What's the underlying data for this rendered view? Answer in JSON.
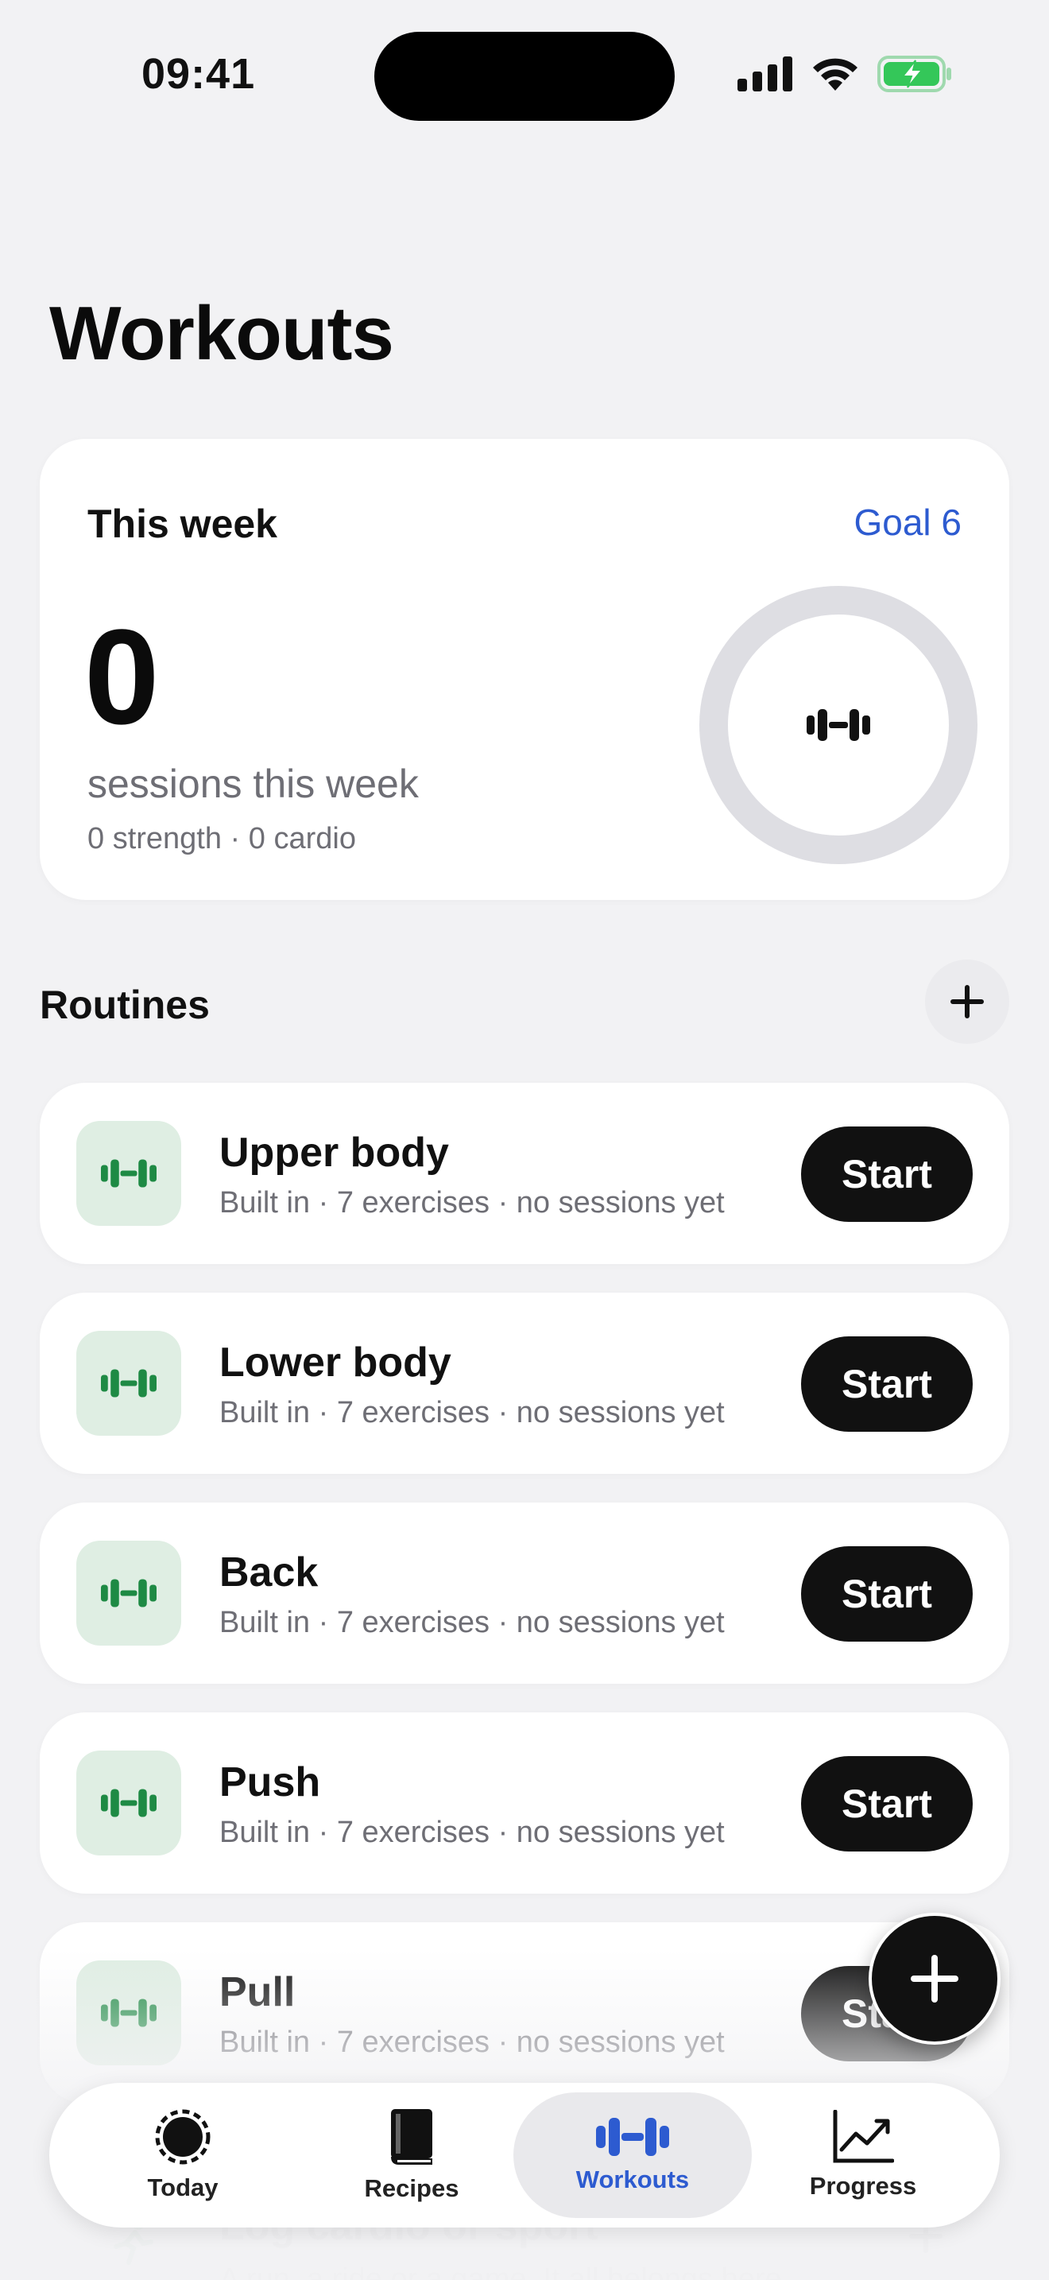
{
  "status_bar": {
    "time": "09:41"
  },
  "page": {
    "title": "Workouts"
  },
  "week": {
    "label": "This week",
    "goal_link": "Goal 6",
    "count": "0",
    "subtitle": "sessions this week",
    "breakdown": "0 strength · 0 cardio",
    "progress_fraction": 0
  },
  "routines_section": {
    "title": "Routines"
  },
  "routines": [
    {
      "name": "Upper body",
      "meta": "Built in · 7 exercises · no sessions yet",
      "start_label": "Start"
    },
    {
      "name": "Lower body",
      "meta": "Built in · 7 exercises · no sessions yet",
      "start_label": "Start"
    },
    {
      "name": "Back",
      "meta": "Built in · 7 exercises · no sessions yet",
      "start_label": "Start"
    },
    {
      "name": "Push",
      "meta": "Built in · 7 exercises · no sessions yet",
      "start_label": "Start"
    },
    {
      "name": "Pull",
      "meta": "Built in · 7 exercises · no sessions yet",
      "start_label": "Start"
    }
  ],
  "cardio_row": {
    "title": "Log cardio or sport",
    "subtitle": "A run, a ride or a game. It all belongs here."
  },
  "tabs": [
    {
      "label": "Today",
      "icon": "today-ring-icon"
    },
    {
      "label": "Recipes",
      "icon": "book-icon"
    },
    {
      "label": "Workouts",
      "icon": "dumbbell-icon"
    },
    {
      "label": "Progress",
      "icon": "trend-chart-icon"
    }
  ],
  "colors": {
    "accent": "#2d5bd0",
    "routine_icon_bg": "#dfeee3",
    "routine_icon": "#1e8a44",
    "battery": "#34c759"
  }
}
